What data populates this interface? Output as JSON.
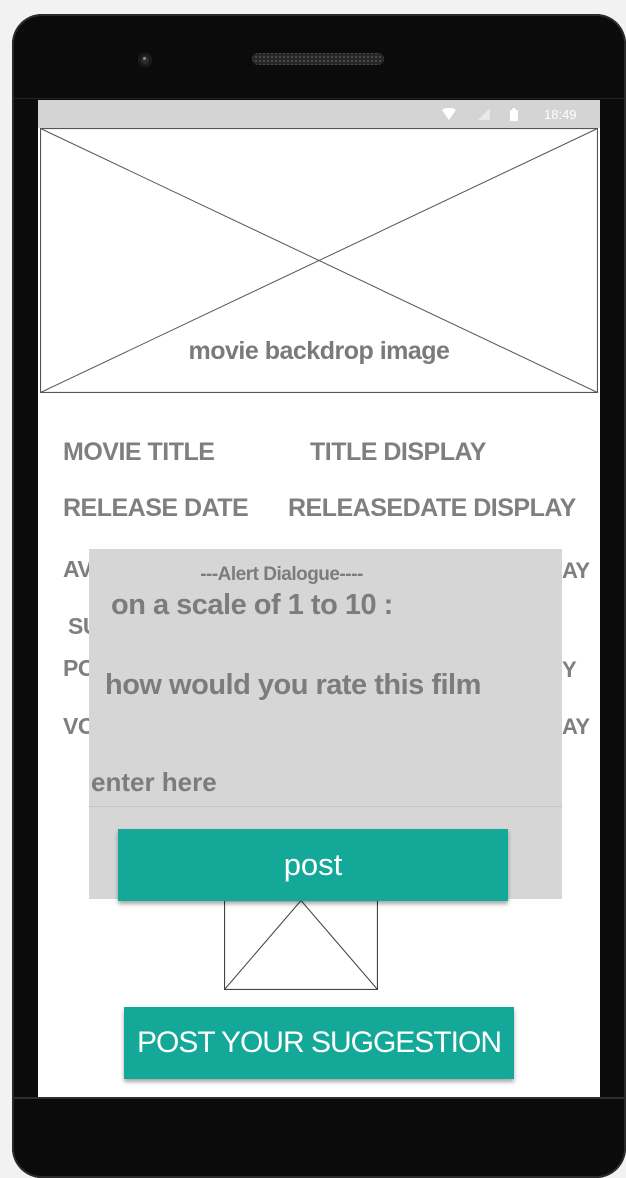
{
  "statusbar": {
    "time": "18:49",
    "icons": [
      "wifi-icon",
      "signal-icon",
      "battery-icon"
    ]
  },
  "backdrop": {
    "label": "movie backdrop image"
  },
  "details": {
    "movie_title_label": "MOVIE TITLE",
    "title_display": "TITLE DISPLAY",
    "release_date_label": "RELEASE DATE",
    "releasedate_display": "RELEASEDATE DISPLAY",
    "partial_left": [
      "AV",
      "SU",
      "PO",
      "VO"
    ],
    "partial_right": [
      "AY",
      "Y",
      "AY"
    ]
  },
  "dialog": {
    "title": "---Alert Dialogue----",
    "question_line1": "on a scale of 1 to 10 :",
    "question_line2": "how would you rate this film",
    "input_placeholder": "enter here",
    "post_label": "post"
  },
  "suggest_button": {
    "label": "POST YOUR SUGGESTION"
  },
  "colors": {
    "accent": "#14a898",
    "dialog_bg": "#d6d6d6",
    "statusbar_bg": "#d4d4d4",
    "label_text": "#7f7f7f"
  }
}
